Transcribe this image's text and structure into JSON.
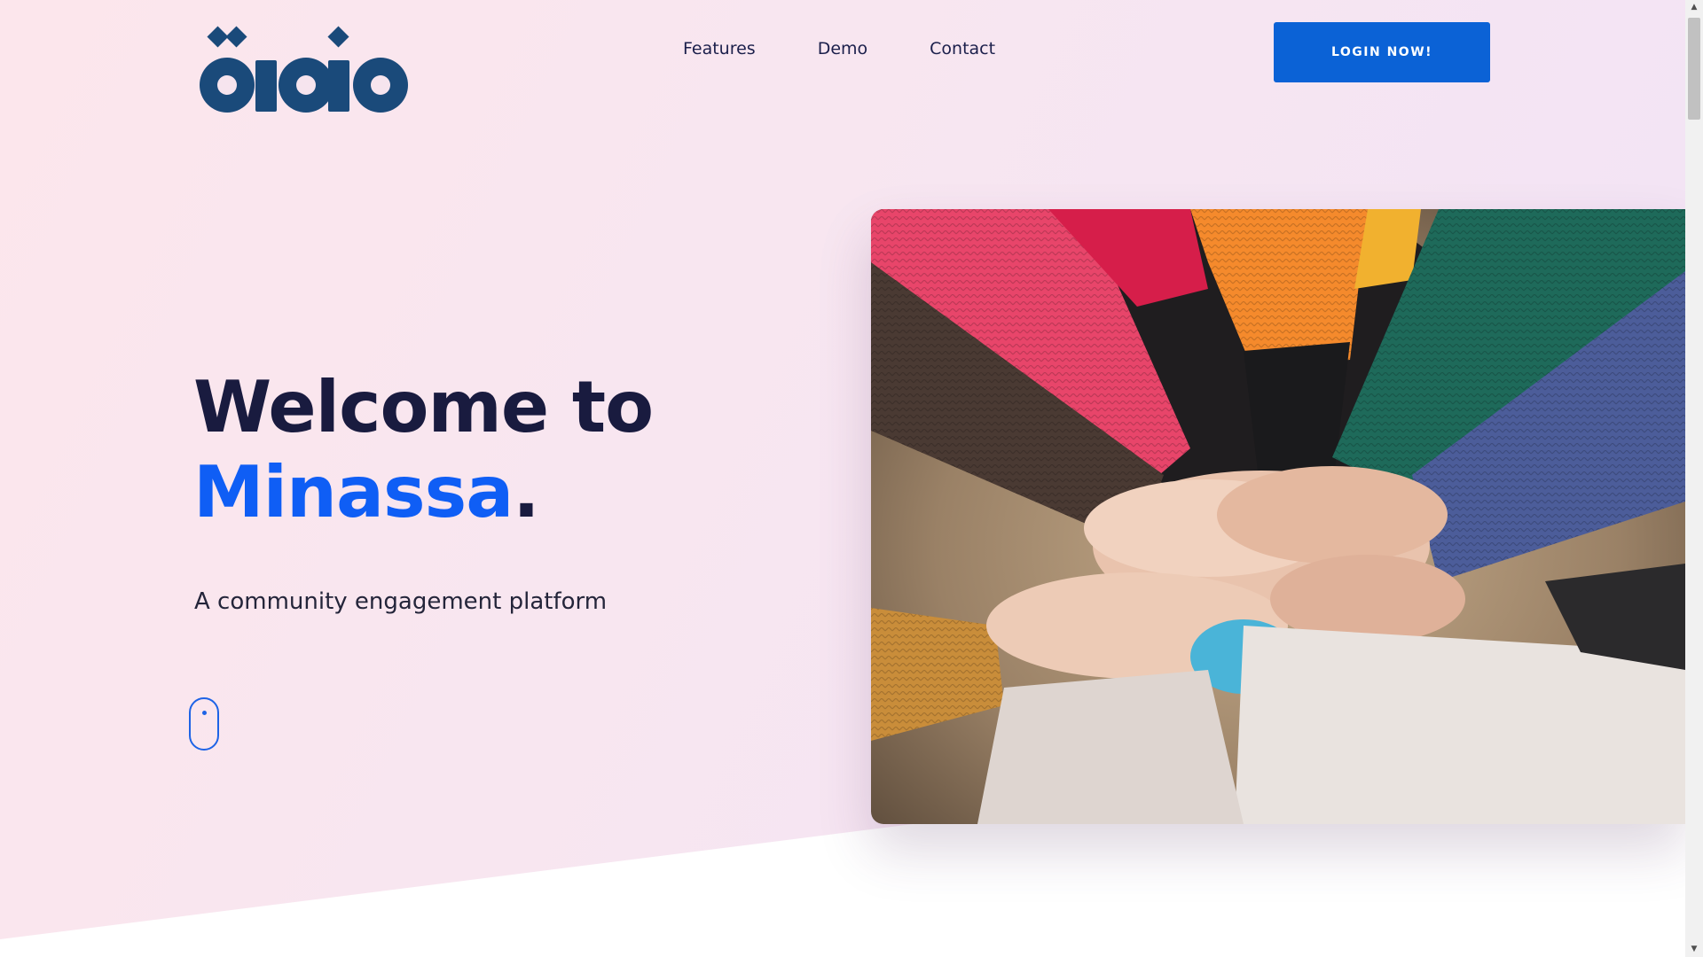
{
  "brand": {
    "logo_text": "öioio"
  },
  "nav": {
    "items": [
      {
        "label": "Features"
      },
      {
        "label": "Demo"
      },
      {
        "label": "Contact"
      }
    ]
  },
  "header": {
    "login_label": "LOGIN NOW!"
  },
  "hero": {
    "headline_line1": "Welcome to",
    "headline_brand": "Minassa",
    "headline_period": ".",
    "subtitle": "A community engagement platform",
    "image_icon": "team-hands-photo",
    "scroll_icon": "mouse-scroll-icon"
  },
  "colors": {
    "accent": "#0b62d6",
    "brand_blue": "#0f5ef5",
    "logo_navy": "#1a4a7a",
    "heading": "#191b3f",
    "background_pink": "#fce6ec",
    "background_lilac": "#f1e3f6"
  },
  "scrollbar": {
    "up_icon": "arrow-up-icon",
    "down_icon": "arrow-down-icon"
  }
}
